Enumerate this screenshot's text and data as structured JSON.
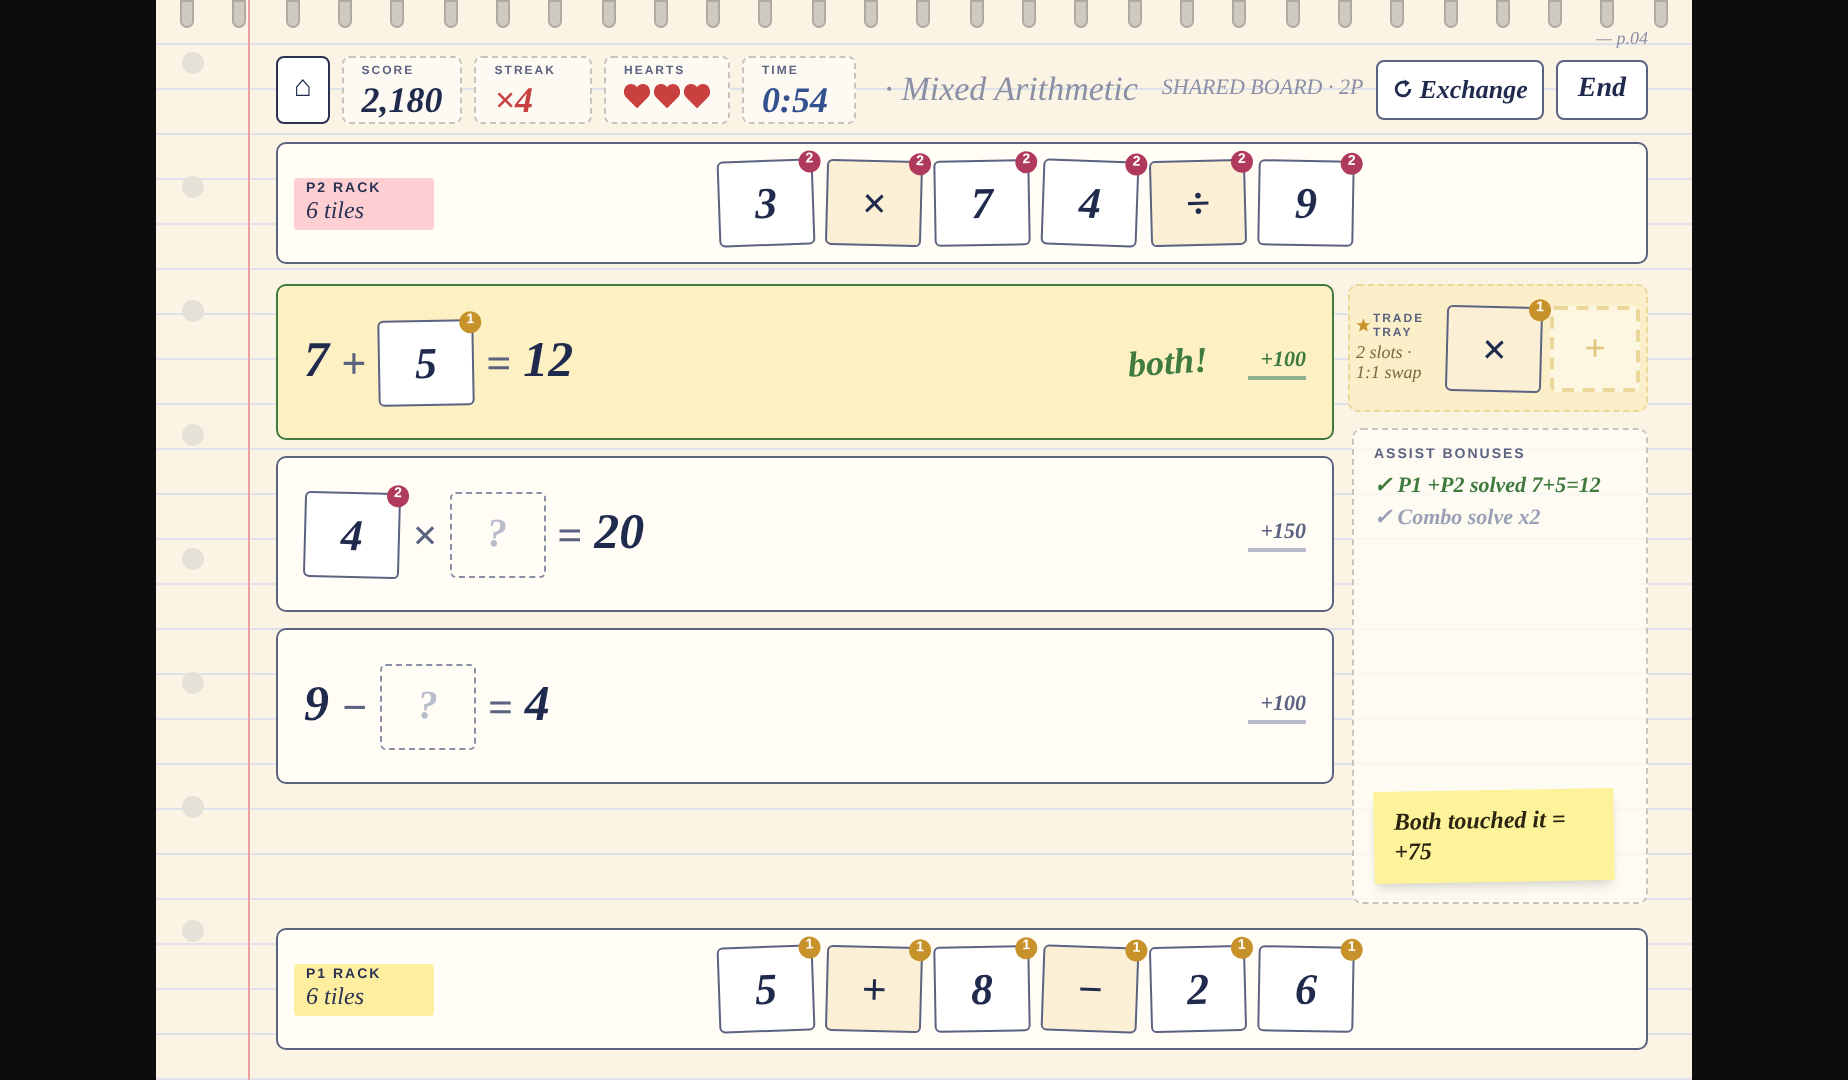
{
  "header": {
    "home": "⌂",
    "score": {
      "label": "SCORE",
      "value": "2,180"
    },
    "streak": {
      "label": "STREAK",
      "value": "×4"
    },
    "hearts": {
      "label": "HEARTS",
      "stars": 3
    },
    "time": {
      "label": "TIME",
      "value": "0:54"
    },
    "subtitle": "· Mixed Arithmetic",
    "board_label": "SHARED BOARD · 2P",
    "page": "— p.04",
    "exchange_button": "Exchange",
    "end_button": "End"
  },
  "p2_rack": {
    "label": "P2 RACK",
    "count": "6 tiles",
    "tiles": [
      {
        "text": "3",
        "kind": "number",
        "owner": "2"
      },
      {
        "text": "×",
        "kind": "op",
        "owner": "2"
      },
      {
        "text": "7",
        "kind": "number",
        "owner": "2"
      },
      {
        "text": "4",
        "kind": "number",
        "owner": "2"
      },
      {
        "text": "÷",
        "kind": "op",
        "owner": "2"
      },
      {
        "text": "9",
        "kind": "number",
        "owner": "2"
      }
    ]
  },
  "equations": [
    {
      "solved": true,
      "tag": "both!",
      "points": "+100",
      "parts": [
        {
          "kind": "text",
          "text": "7"
        },
        {
          "kind": "op",
          "text": "+"
        },
        {
          "kind": "tile",
          "text": "5",
          "owner": "1"
        },
        {
          "kind": "op",
          "text": "="
        },
        {
          "kind": "text",
          "text": "12"
        }
      ]
    },
    {
      "solved": false,
      "points": "+150",
      "parts": [
        {
          "kind": "tile",
          "text": "4",
          "owner": "2"
        },
        {
          "kind": "op",
          "text": "×"
        },
        {
          "kind": "slot",
          "text": "?"
        },
        {
          "kind": "op",
          "text": "="
        },
        {
          "kind": "text",
          "text": "20"
        }
      ]
    },
    {
      "solved": false,
      "points": "+100",
      "parts": [
        {
          "kind": "text",
          "text": "9"
        },
        {
          "kind": "op",
          "text": "−"
        },
        {
          "kind": "slot",
          "text": "?"
        },
        {
          "kind": "op",
          "text": "="
        },
        {
          "kind": "text",
          "text": "4"
        }
      ]
    }
  ],
  "trade_tray": {
    "label": "TRADE TRAY",
    "note": "2 slots · 1:1 swap",
    "slots": [
      {
        "kind": "tile",
        "text": "×",
        "owner": "1"
      },
      {
        "kind": "empty",
        "text": "+"
      }
    ]
  },
  "assist_bonuses": {
    "label": "ASSIST BONUSES",
    "items": [
      {
        "text": "✓ P1 +P2 solved 7+5=12",
        "done": true
      },
      {
        "text": "✓ Combo solve x2",
        "done": false
      }
    ],
    "note": "Both touched it = +75"
  },
  "p1_rack": {
    "label": "P1 RACK",
    "count": "6 tiles",
    "tiles": [
      {
        "text": "5",
        "kind": "number",
        "owner": "1"
      },
      {
        "text": "+",
        "kind": "op",
        "owner": "1"
      },
      {
        "text": "8",
        "kind": "number",
        "owner": "1"
      },
      {
        "text": "−",
        "kind": "op",
        "owner": "1"
      },
      {
        "text": "2",
        "kind": "number",
        "owner": "1"
      },
      {
        "text": "6",
        "kind": "number",
        "owner": "1"
      }
    ]
  }
}
